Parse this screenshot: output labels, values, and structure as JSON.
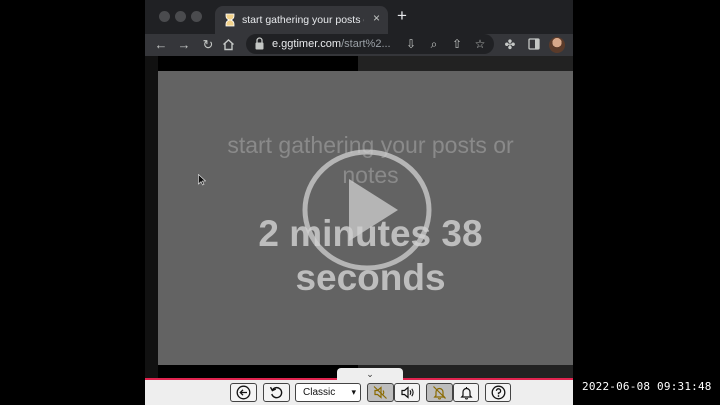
{
  "browser": {
    "tab_title": "start gathering your posts or n",
    "tab_close": "×",
    "new_tab": "+",
    "url_host": "e.ggtimer.com",
    "url_path": "/start%2..."
  },
  "timer": {
    "message": "start gathering your posts or notes",
    "countdown": "2 minutes 38 seconds"
  },
  "controls": {
    "collapse": "⌄",
    "mode_selected": "Classic",
    "mode_caret": "▾"
  },
  "overlay": {
    "timestamp": "2022-06-08 09:31:48"
  },
  "colors": {
    "accent": "#e0244f",
    "stage": "#636363",
    "toolbar": "#35363a"
  },
  "icons": [
    "back-icon",
    "forward-icon",
    "reload-icon",
    "home-icon",
    "lock-icon",
    "install-icon",
    "zoom-icon",
    "share-icon",
    "star-icon",
    "extensions-icon",
    "sidebar-icon",
    "play-icon",
    "circle-arrow-left-icon",
    "restart-icon",
    "mute-icon",
    "volume-icon",
    "bell-off-icon",
    "bell-icon",
    "help-icon"
  ]
}
